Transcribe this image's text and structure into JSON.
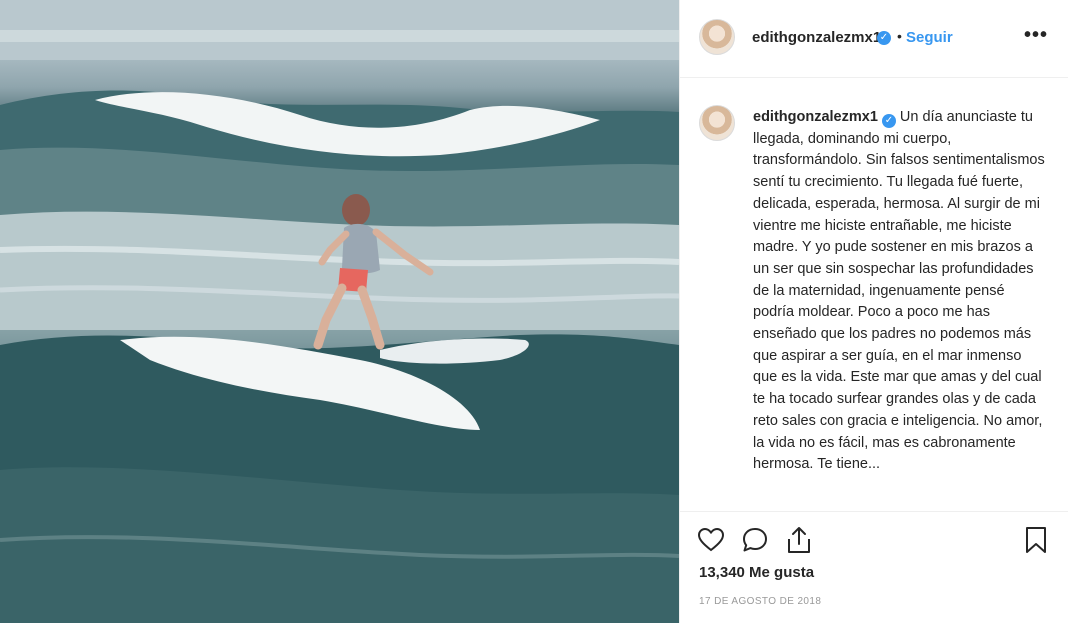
{
  "header": {
    "username": "edithgonzalezmx1",
    "separator": "•",
    "follow_label": "Seguir",
    "more_label": "•••"
  },
  "caption": {
    "username": "edithgonzalezmx1",
    "text": "Un día anunciaste tu llegada, dominando mi cuerpo, transformándolo. Sin falsos sentimentalismos sentí tu crecimiento. Tu llegada fué fuerte, delicada, esperada, hermosa. Al surgir de mi vientre me hiciste entrañable, me hiciste madre. Y yo pude sostener en mis brazos a un ser que sin sospechar las profundidades de la maternidad, ingenuamente pensé podría moldear. Poco a poco me has enseñado que los padres no podemos más que aspirar a ser guía, en el mar inmenso que es la vida. Este mar que amas y del cual te ha tocado surfear grandes olas y de cada reto sales con gracia e inteligencia. No amor, la vida no es fácil, mas es cabronamente hermosa. Te tiene..."
  },
  "icons": {
    "verified": "verified-badge-icon",
    "like": "heart-icon",
    "comment": "comment-bubble-icon",
    "share": "share-icon",
    "save": "bookmark-icon"
  },
  "stats": {
    "likes": "13,340 Me gusta"
  },
  "date": "17 DE AGOSTO DE 2018",
  "colors": {
    "accent": "#3897f0",
    "text": "#262626",
    "muted": "#999999",
    "border": "#efefef"
  }
}
